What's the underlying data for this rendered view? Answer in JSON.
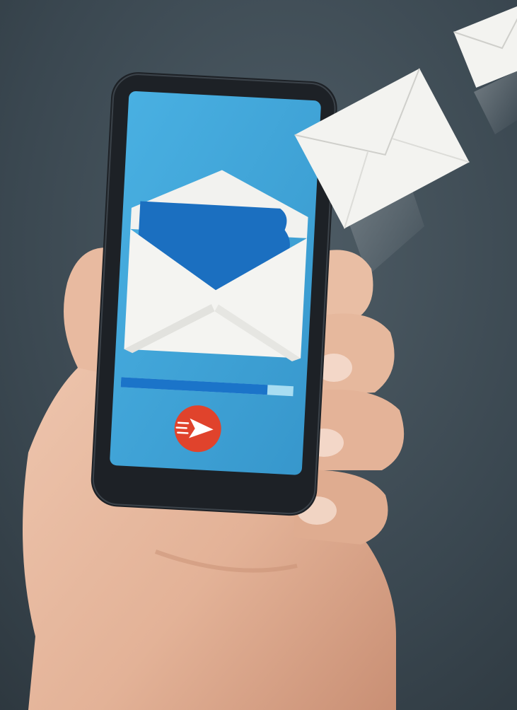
{
  "scene": {
    "background": "#3a4750",
    "background_light": "#4f5d66",
    "background_dark": "#2c363d",
    "skin": "#e9bfa6",
    "skin_shadow": "#c88f73",
    "phone_body": "#1d2126",
    "screen_color": "#3ea6da",
    "envelope_white": "#f1f1ef",
    "letter_blue": "#1b6fc0"
  },
  "phone_screen": {
    "progress": 0.85,
    "progress_fill_color": "#1b74c9",
    "progress_track_color": "#a8ddf2",
    "send_button": {
      "color": "#e0432c",
      "icon": "paper-plane-icon"
    }
  },
  "flying_envelopes": {
    "count": 2,
    "color": "#f3f3f0"
  }
}
